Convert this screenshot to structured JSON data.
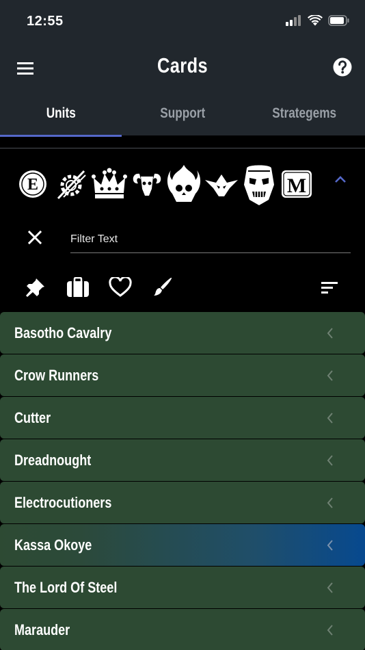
{
  "status": {
    "time": "12:55"
  },
  "appbar": {
    "title": "Cards"
  },
  "tabs": [
    {
      "label": "Units",
      "active": true
    },
    {
      "label": "Support",
      "active": false
    },
    {
      "label": "Strategems",
      "active": false
    }
  ],
  "factions": [
    {
      "name": "faction-e-emblem-icon",
      "letter": "E"
    },
    {
      "name": "faction-gear-slash-icon",
      "letter": ""
    },
    {
      "name": "faction-crown-icon",
      "letter": ""
    },
    {
      "name": "faction-ram-skull-icon",
      "letter": ""
    },
    {
      "name": "faction-flaming-skull-icon",
      "letter": ""
    },
    {
      "name": "faction-spiked-face-icon",
      "letter": ""
    },
    {
      "name": "faction-mask-icon",
      "letter": ""
    },
    {
      "name": "faction-m-emblem-icon",
      "letter": "M"
    }
  ],
  "filter": {
    "placeholder": "Filter Text",
    "value": ""
  },
  "list": {
    "items": [
      {
        "label": "Basotho Cavalry",
        "selected": false
      },
      {
        "label": "Crow Runners",
        "selected": false
      },
      {
        "label": "Cutter",
        "selected": false
      },
      {
        "label": "Dreadnought",
        "selected": false
      },
      {
        "label": "Electrocutioners",
        "selected": false
      },
      {
        "label": "Kassa Okoye",
        "selected": true
      },
      {
        "label": "The Lord Of Steel",
        "selected": false
      },
      {
        "label": "Marauder",
        "selected": false
      }
    ]
  },
  "colors": {
    "header_bg": "#21272d",
    "tab_indicator": "#5568c9",
    "row_bg": "#2d4a33",
    "selected_row_end": "#07498f",
    "collapse_arrow": "#5568c9"
  }
}
